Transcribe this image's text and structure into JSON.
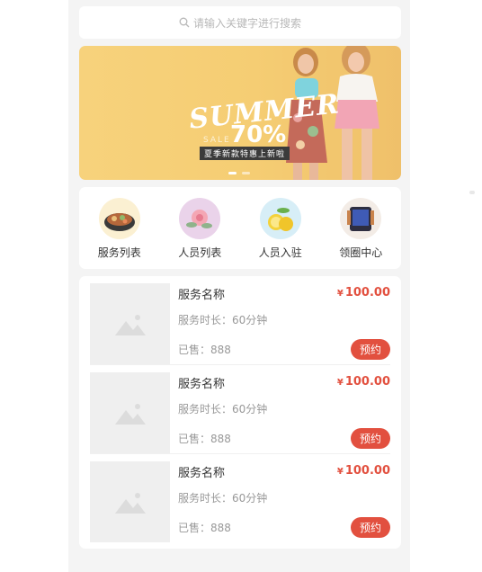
{
  "search": {
    "placeholder": "请输入关键字进行搜索",
    "icon": "search-icon"
  },
  "banner": {
    "headline": "SUMMER",
    "sale": "SALE",
    "discount": "70%",
    "caption": "夏季新款特惠上新啦",
    "dots": 2,
    "active_dot": 0
  },
  "categories": [
    {
      "label": "服务列表",
      "icon": "hotpot-dish-icon"
    },
    {
      "label": "人员列表",
      "icon": "flower-icon"
    },
    {
      "label": "人员入驻",
      "icon": "lemon-icon"
    },
    {
      "label": "领圈中心",
      "icon": "device-icon"
    }
  ],
  "services": [
    {
      "name": "服务名称",
      "currency": "¥",
      "price": "100.00",
      "duration": "服务时长：60分钟",
      "sold": "已售：888",
      "button": "预约"
    },
    {
      "name": "服务名称",
      "currency": "¥",
      "price": "100.00",
      "duration": "服务时长：60分钟",
      "sold": "已售：888",
      "button": "预约"
    },
    {
      "name": "服务名称",
      "currency": "¥",
      "price": "100.00",
      "duration": "服务时长：60分钟",
      "sold": "已售：888",
      "button": "预约"
    }
  ],
  "colors": {
    "accent": "#e2503f",
    "background": "#f4f4f4",
    "banner": "#f5cd73"
  }
}
